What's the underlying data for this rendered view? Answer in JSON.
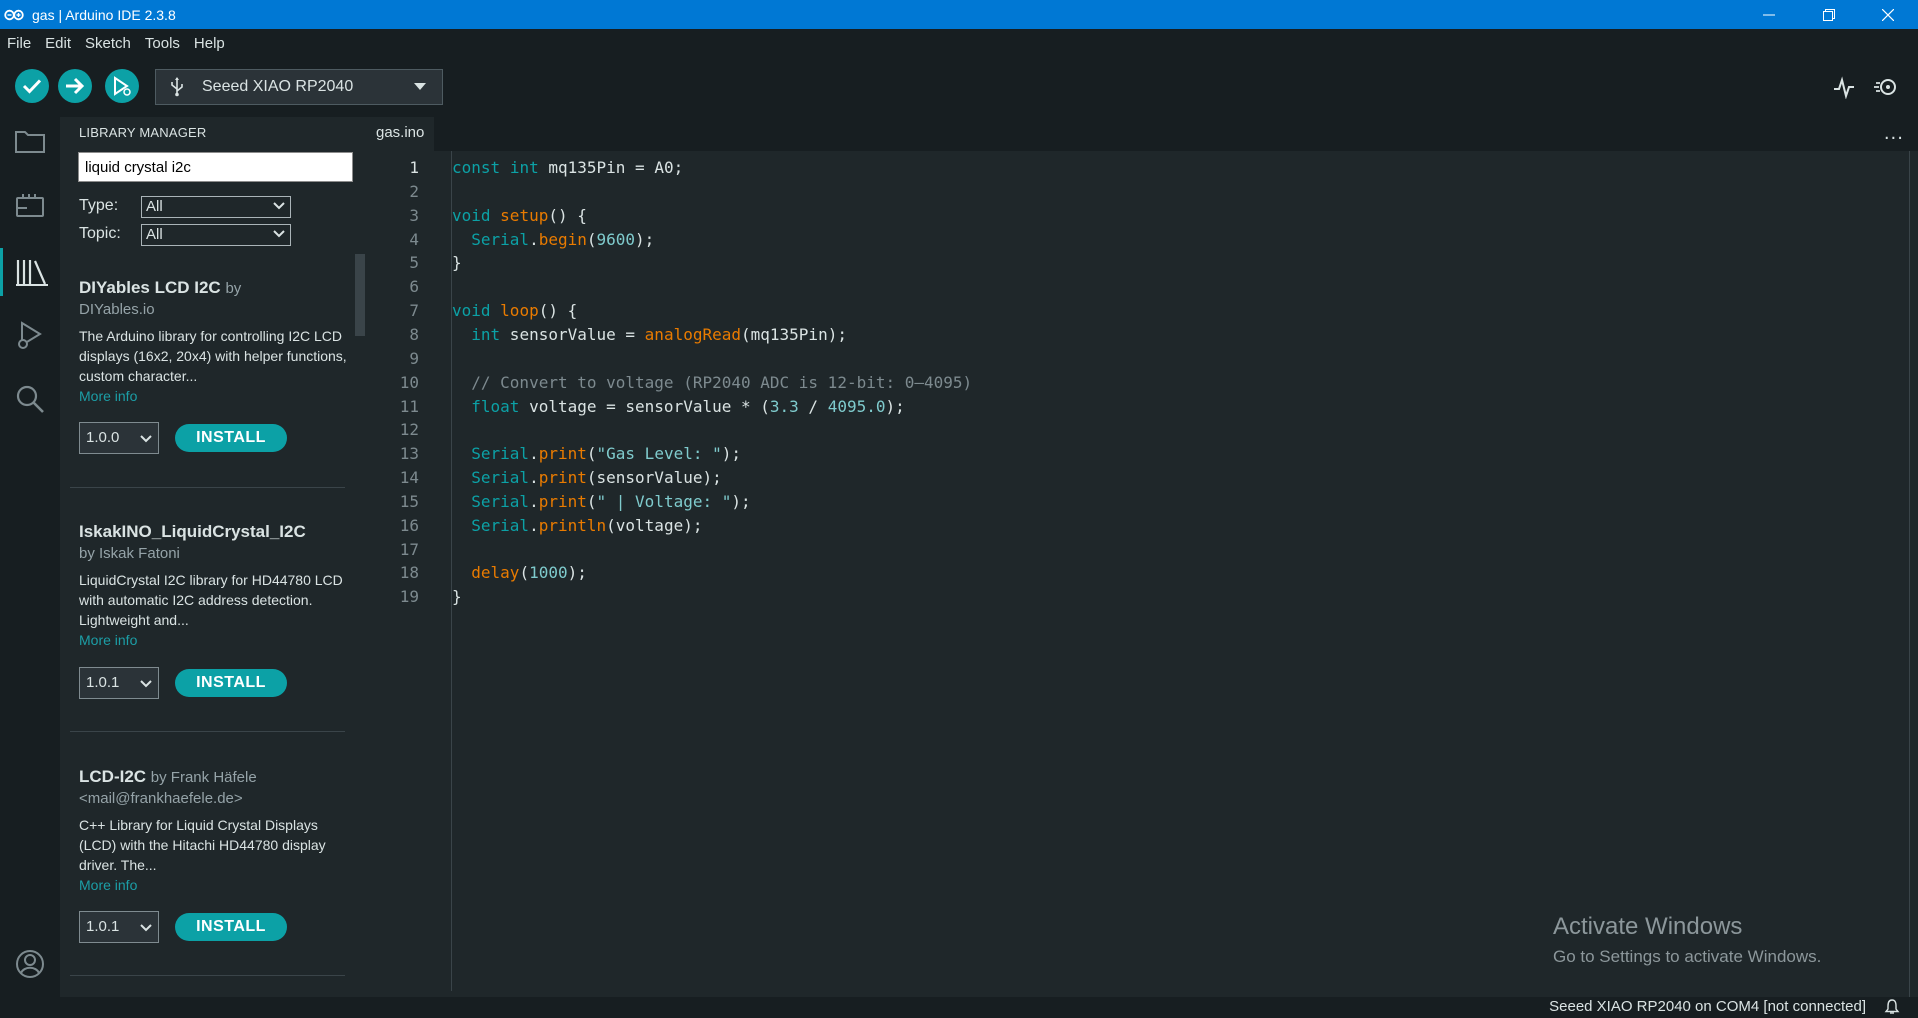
{
  "window": {
    "title": "gas | Arduino IDE 2.3.8",
    "titlebar_color": "#0078d4"
  },
  "menu": [
    "File",
    "Edit",
    "Sketch",
    "Tools",
    "Help"
  ],
  "toolbar": {
    "board": "Seeed XIAO RP2040",
    "verify_icon": "check-icon",
    "upload_icon": "arrow-right-icon",
    "debug_icon": "debug-icon",
    "accent": "#0ca1a6"
  },
  "library_manager": {
    "header": "LIBRARY MANAGER",
    "search_value": "liquid crystal i2c",
    "filters": {
      "type_label": "Type:",
      "type_value": "All",
      "topic_label": "Topic:",
      "topic_value": "All"
    },
    "items": [
      {
        "name": "DIYables LCD I2C",
        "by": "by",
        "author": "DIYables.io",
        "description": "The Arduino library for controlling I2C LCD displays (16x2, 20x4) with helper functions, custom character...",
        "more": "More info",
        "version": "1.0.0",
        "install": "INSTALL"
      },
      {
        "name": "IskakINO_LiquidCrystal_I2C",
        "author": "by Iskak Fatoni",
        "description": "LiquidCrystal I2C library for HD44780 LCD with automatic I2C address detection. Lightweight and...",
        "more": "More info",
        "version": "1.0.1",
        "install": "INSTALL"
      },
      {
        "name": "LCD-I2C",
        "by": "by Frank Häfele",
        "author": "<mail@frankhaefele.de>",
        "description": "C++ Library for Liquid Crystal Displays (LCD) with the Hitachi HD44780 display driver. The...",
        "more": "More info",
        "version": "1.0.1",
        "install": "INSTALL"
      }
    ]
  },
  "editor": {
    "tab": "gas.ino",
    "more": "...",
    "current_line": 1,
    "lines": [
      {
        "n": "1",
        "text": "const int mq135Pin = A0;"
      },
      {
        "n": "2",
        "text": ""
      },
      {
        "n": "3",
        "text": "void setup() {"
      },
      {
        "n": "4",
        "text": "  Serial.begin(9600);"
      },
      {
        "n": "5",
        "text": "}"
      },
      {
        "n": "6",
        "text": ""
      },
      {
        "n": "7",
        "text": "void loop() {"
      },
      {
        "n": "8",
        "text": "  int sensorValue = analogRead(mq135Pin);"
      },
      {
        "n": "9",
        "text": ""
      },
      {
        "n": "10",
        "text": "  // Convert to voltage (RP2040 ADC is 12-bit: 0–4095)"
      },
      {
        "n": "11",
        "text": "  float voltage = sensorValue * (3.3 / 4095.0);"
      },
      {
        "n": "12",
        "text": ""
      },
      {
        "n": "13",
        "text": "  Serial.print(\"Gas Level: \");"
      },
      {
        "n": "14",
        "text": "  Serial.print(sensorValue);"
      },
      {
        "n": "15",
        "text": "  Serial.print(\" | Voltage: \");"
      },
      {
        "n": "16",
        "text": "  Serial.println(voltage);"
      },
      {
        "n": "17",
        "text": ""
      },
      {
        "n": "18",
        "text": "  delay(1000);"
      },
      {
        "n": "19",
        "text": "}"
      }
    ]
  },
  "watermark": {
    "line1": "Activate Windows",
    "line2": "Go to Settings to activate Windows."
  },
  "statusbar": {
    "text": "Seeed XIAO RP2040 on COM4 [not connected]"
  }
}
